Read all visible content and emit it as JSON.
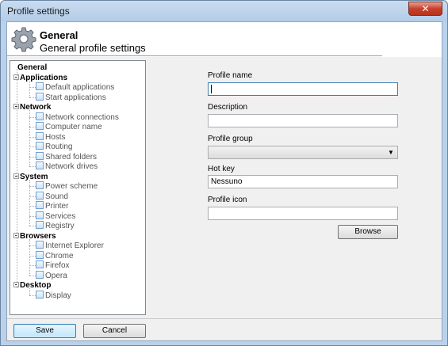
{
  "window": {
    "title": "Profile settings",
    "close_label": "✕"
  },
  "header": {
    "title": "General",
    "subtitle": "General profile settings",
    "icon": "gear-icon"
  },
  "tree": {
    "categories": [
      {
        "label": "General",
        "children": []
      },
      {
        "label": "Applications",
        "children": [
          "Default applications",
          "Start applications"
        ]
      },
      {
        "label": "Network",
        "children": [
          "Network connections",
          "Computer name",
          "Hosts",
          "Routing",
          "Shared folders",
          "Network drives"
        ]
      },
      {
        "label": "System",
        "children": [
          "Power scheme",
          "Sound",
          "Printer",
          "Services",
          "Registry"
        ]
      },
      {
        "label": "Browsers",
        "children": [
          "Internet Explorer",
          "Chrome",
          "Firefox",
          "Opera"
        ]
      },
      {
        "label": "Desktop",
        "children": [
          "Display"
        ]
      }
    ]
  },
  "form": {
    "profile_name_label": "Profile name",
    "profile_name_value": "",
    "description_label": "Description",
    "description_value": "",
    "profile_group_label": "Profile group",
    "profile_group_value": "",
    "hot_key_label": "Hot key",
    "hot_key_value": "Nessuno",
    "profile_icon_label": "Profile icon",
    "profile_icon_value": "",
    "browse_label": "Browse"
  },
  "footer": {
    "save_label": "Save",
    "cancel_label": "Cancel"
  }
}
